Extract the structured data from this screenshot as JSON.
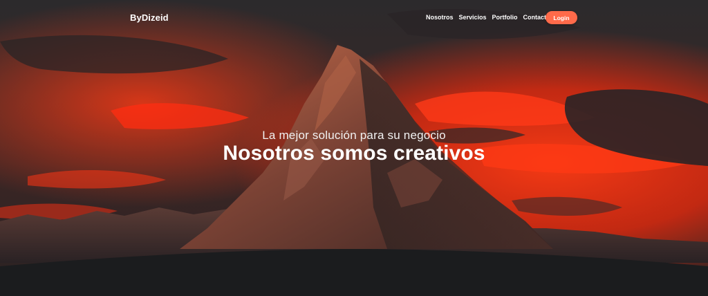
{
  "nav": {
    "brand": "ByDizeid",
    "links": [
      "Nosotros",
      "Servicios",
      "Portfolio",
      "Contacto"
    ],
    "login_label": "Login",
    "accent_color": "#ff6a4a"
  },
  "hero": {
    "subtitle": "La mejor solución para su negocio",
    "title": "Nosotros somos creativos",
    "background_image": "red-sky-mountain-peak"
  },
  "colors": {
    "sky_red": "#ff2a12",
    "sky_dark": "#2b2729",
    "base_dark": "#1b1c1e"
  }
}
